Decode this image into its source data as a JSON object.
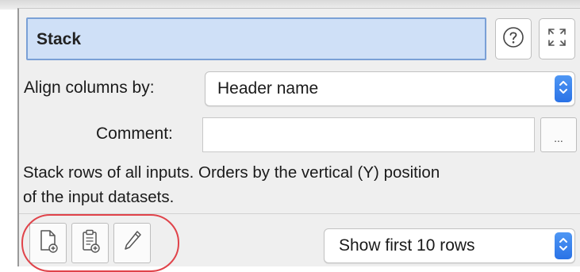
{
  "header": {
    "title": "Stack",
    "help_icon": "question-circle-icon",
    "expand_icon": "expand-arrows-icon"
  },
  "form": {
    "align_label": "Align columns by:",
    "align_value": "Header name",
    "comment_label": "Comment:",
    "comment_value": "",
    "comment_button_label": "..."
  },
  "description": {
    "line1": "Stack rows of all inputs. Orders by the vertical (Y) position",
    "line2": "of the input datasets."
  },
  "toolbar": {
    "buttons": [
      {
        "icon": "new-document-icon"
      },
      {
        "icon": "paste-clipboard-icon"
      },
      {
        "icon": "pencil-icon"
      }
    ],
    "rows_select_value": "Show first 10 rows"
  },
  "colors": {
    "title_bg": "#cfe0f7",
    "title_border": "#7aa0d6",
    "stepper_blue": "#3b82f0",
    "highlight_ring": "#e0434a",
    "panel_bg": "#efefef"
  }
}
